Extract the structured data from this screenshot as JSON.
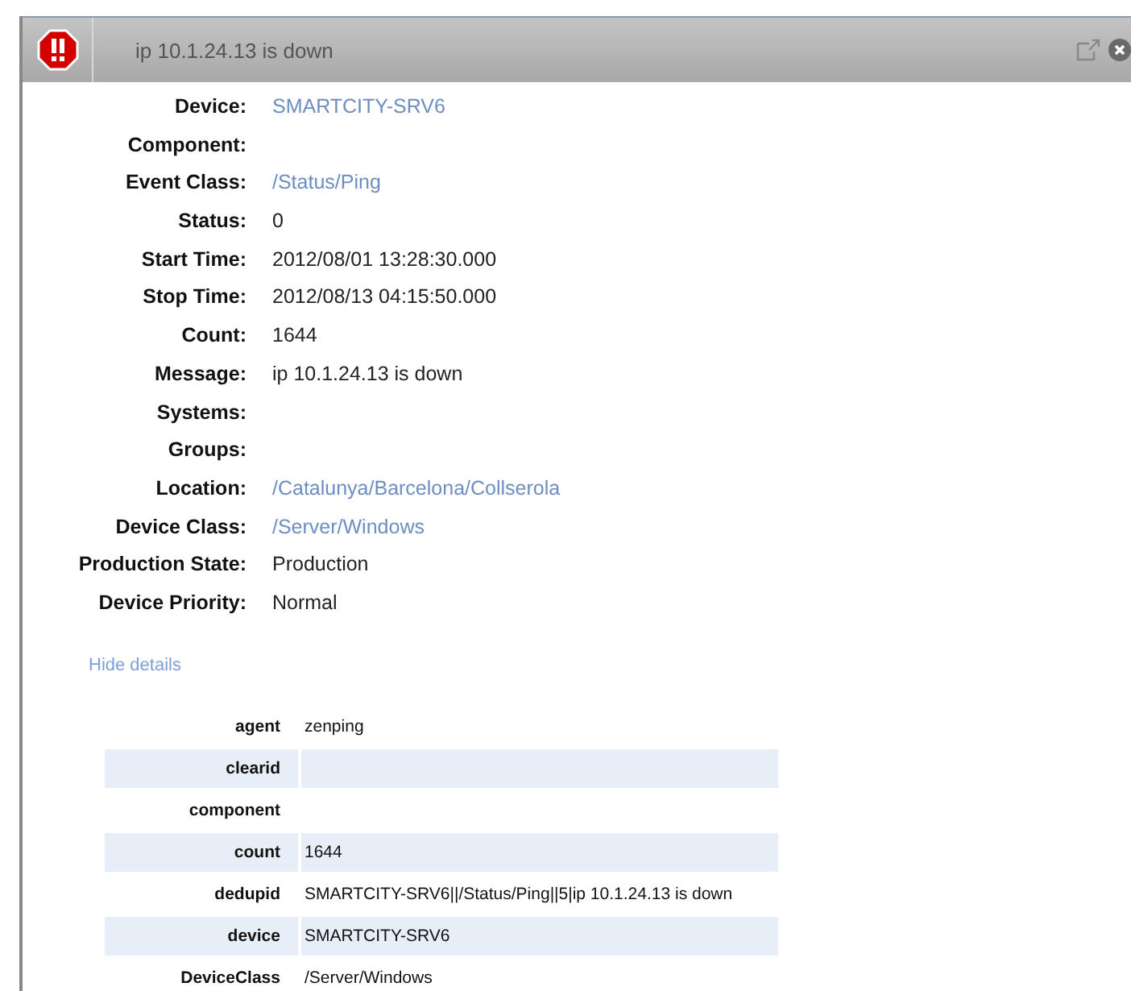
{
  "header": {
    "title": "ip 10.1.24.13 is down",
    "critical": true
  },
  "fields": [
    {
      "label": "Device:",
      "value": "SMARTCITY-SRV6",
      "kind": "link"
    },
    {
      "label": "Component:"
    },
    {
      "label": "Event Class:",
      "value": "/Status/Ping",
      "kind": "link"
    },
    {
      "label": "Status:",
      "value": "0",
      "kind": "text"
    },
    {
      "label": "Start Time:",
      "value": "2012/08/01 13:28:30.000",
      "kind": "text"
    },
    {
      "label": "Stop Time:",
      "value": "2012/08/13 04:15:50.000",
      "kind": "text"
    },
    {
      "label": "Count:",
      "value": "1644",
      "kind": "text"
    },
    {
      "label": "Message:",
      "value": "ip 10.1.24.13 is down",
      "kind": "text"
    },
    {
      "label": "Systems:"
    },
    {
      "label": "Groups:"
    },
    {
      "label": "Location:",
      "value": "/Catalunya/Barcelona/Collserola",
      "kind": "link"
    },
    {
      "label": "Device Class:",
      "value": "/Server/Windows",
      "kind": "link"
    },
    {
      "label": "Production State:",
      "value": "Production",
      "kind": "text"
    },
    {
      "label": "Device Priority:",
      "value": "Normal",
      "kind": "text"
    }
  ],
  "details_link": "Hide details",
  "details": [
    {
      "key": "agent",
      "value": "zenping"
    },
    {
      "key": "clearid"
    },
    {
      "key": "component"
    },
    {
      "key": "count",
      "value": "1644"
    },
    {
      "key": "dedupid",
      "value": "SMARTCITY-SRV6||/Status/Ping||5|ip 10.1.24.13 is down"
    },
    {
      "key": "device",
      "value": "SMARTCITY-SRV6"
    },
    {
      "key": "DeviceClass",
      "value": "/Server/Windows"
    }
  ]
}
